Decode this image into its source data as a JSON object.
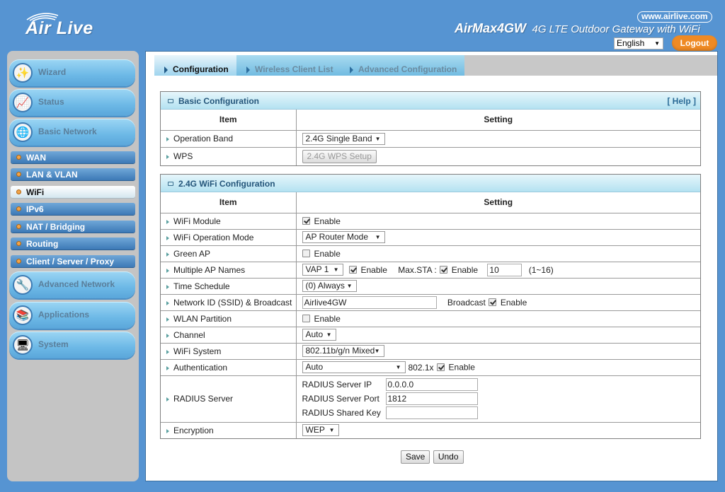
{
  "header": {
    "brand": "Air Live",
    "url": "www.airlive.com",
    "model": "AirMax4GW",
    "tagline": "4G LTE Outdoor Gateway with WiFi",
    "language": "English",
    "logout_label": "Logout"
  },
  "sidebar": {
    "main_items": [
      {
        "label": "Wizard",
        "icon": "wand-icon"
      },
      {
        "label": "Status",
        "icon": "chart-icon"
      },
      {
        "label": "Basic Network",
        "icon": "globe-icon"
      },
      {
        "label": "Advanced Network",
        "icon": "tools-icon"
      },
      {
        "label": "Applications",
        "icon": "books-icon"
      },
      {
        "label": "System",
        "icon": "computer-icon"
      }
    ],
    "sub_items": [
      {
        "label": "WAN",
        "active": false
      },
      {
        "label": "LAN & VLAN",
        "active": false
      },
      {
        "label": "WiFi",
        "active": true
      },
      {
        "label": "IPv6",
        "active": false
      },
      {
        "label": "NAT / Bridging",
        "active": false
      },
      {
        "label": "Routing",
        "active": false
      },
      {
        "label": "Client / Server / Proxy",
        "active": false
      }
    ]
  },
  "tabs": [
    {
      "label": "Configuration",
      "active": true
    },
    {
      "label": "Wireless Client List",
      "active": false
    },
    {
      "label": "Advanced Configuration",
      "active": false
    }
  ],
  "basic": {
    "title": "Basic Configuration",
    "help": "[ Help ]",
    "col_item": "Item",
    "col_setting": "Setting",
    "operation_band_label": "Operation Band",
    "operation_band_value": "2.4G Single Band",
    "wps_label": "WPS",
    "wps_button": "2.4G WPS Setup"
  },
  "wifi": {
    "title": "2.4G WiFi Configuration",
    "col_item": "Item",
    "col_setting": "Setting",
    "enable": "Enable",
    "module_label": "WiFi Module",
    "module_enabled": true,
    "op_mode_label": "WiFi Operation Mode",
    "op_mode_value": "AP Router Mode",
    "green_ap_label": "Green AP",
    "green_ap_enabled": false,
    "multi_ap_label": "Multiple AP Names",
    "vap_value": "VAP 1",
    "vap_enabled": true,
    "max_sta_label": "Max.STA :",
    "max_sta_enabled": true,
    "max_sta_value": "10",
    "max_sta_range": "(1~16)",
    "schedule_label": "Time Schedule",
    "schedule_value": "(0) Always",
    "ssid_label": "Network ID (SSID) & Broadcast",
    "ssid_value": "Airlive4GW",
    "broadcast_label": "Broadcast",
    "broadcast_enabled": true,
    "partition_label": "WLAN Partition",
    "partition_enabled": false,
    "channel_label": "Channel",
    "channel_value": "Auto",
    "system_label": "WiFi System",
    "system_value": "802.11b/g/n Mixed",
    "auth_label": "Authentication",
    "auth_value": "Auto",
    "dot1x_label": "802.1x",
    "dot1x_enabled": true,
    "radius_label": "RADIUS Server",
    "radius_ip_label": "RADIUS Server IP",
    "radius_ip_value": "0.0.0.0",
    "radius_port_label": "RADIUS Server Port",
    "radius_port_value": "1812",
    "radius_key_label": "RADIUS Shared Key",
    "radius_key_value": "",
    "encryption_label": "Encryption",
    "encryption_value": "WEP"
  },
  "actions": {
    "save": "Save",
    "undo": "Undo"
  }
}
